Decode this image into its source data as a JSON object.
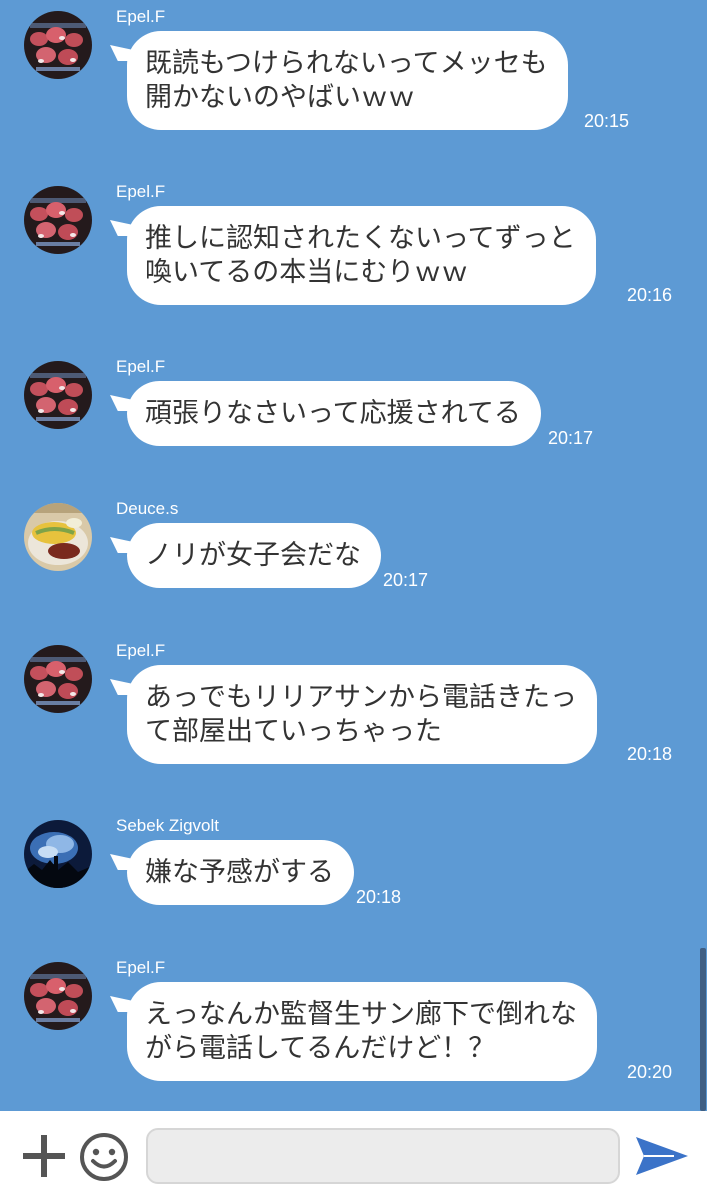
{
  "messages": [
    {
      "sender": "Epel.F",
      "avatar": "meat-platter",
      "lines": [
        "既読もつけられないってメッセも",
        "開かないのやばいｗｗ"
      ],
      "time": "20:15"
    },
    {
      "sender": "Epel.F",
      "avatar": "meat-platter",
      "lines": [
        "推しに認知されたくないってずっと",
        "喚いてるの本当にむりｗｗ"
      ],
      "time": "20:16"
    },
    {
      "sender": "Epel.F",
      "avatar": "meat-platter",
      "lines": [
        "頑張りなさいって応援されてる"
      ],
      "time": "20:17"
    },
    {
      "sender": "Deuce.s",
      "avatar": "omurice",
      "lines": [
        "ノリが女子会だな"
      ],
      "time": "20:17"
    },
    {
      "sender": "Epel.F",
      "avatar": "meat-platter",
      "lines": [
        "あっでもリリアサンから電話きたっ",
        "て部屋出ていっちゃった"
      ],
      "time": "20:18"
    },
    {
      "sender": "Sebek Zigvolt",
      "avatar": "night-sky",
      "lines": [
        "嫌な予感がする"
      ],
      "time": "20:18"
    },
    {
      "sender": "Epel.F",
      "avatar": "meat-platter",
      "lines": [
        "えっなんか監督生サン廊下で倒れな",
        "がら電話してるんだけど！？"
      ],
      "time": "20:20"
    }
  ],
  "input": {
    "value": "",
    "placeholder": ""
  },
  "icons": {
    "attach": "plus-icon",
    "sticker": "smiley-icon",
    "send": "send-icon"
  },
  "colors": {
    "chat_background": "#5d9ad4",
    "bubble": "#ffffff",
    "bubble_text": "#333333",
    "send_accent": "#3b73c8"
  }
}
